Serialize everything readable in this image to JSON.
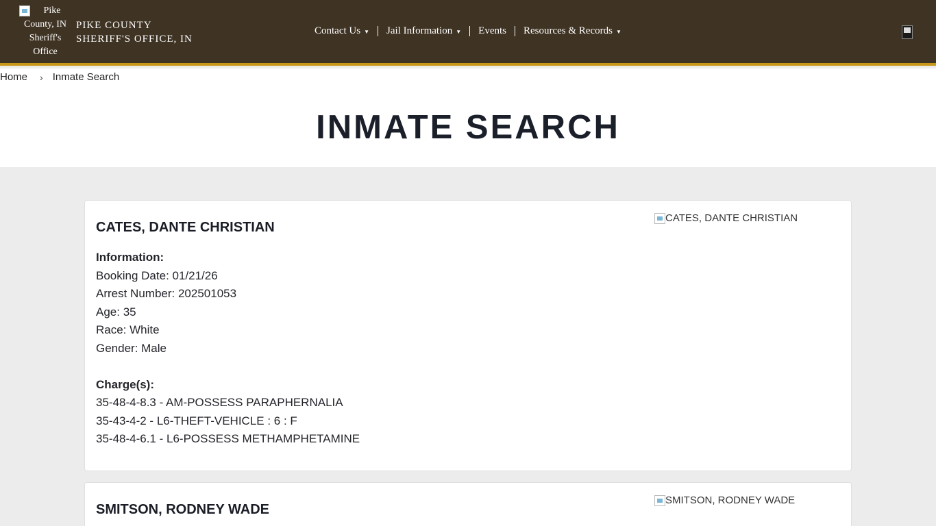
{
  "header": {
    "logo_alt": "Pike County, IN Sheriff's Office",
    "logo_lines": [
      "Pike",
      "County, IN",
      "Sheriff's",
      "Office"
    ],
    "site_name_line1": "PIKE COUNTY",
    "site_name_line2": "SHERIFF'S OFFICE, IN",
    "nav": [
      {
        "label": "Contact Us",
        "has_dropdown": true
      },
      {
        "label": "Jail Information",
        "has_dropdown": true
      },
      {
        "label": "Events",
        "has_dropdown": false
      },
      {
        "label": "Resources & Records",
        "has_dropdown": true
      }
    ],
    "colors": {
      "bar": "#3f3323",
      "accent": "#c9981b"
    }
  },
  "breadcrumb": {
    "home": "Home",
    "separator": "›",
    "current": "Inmate Search"
  },
  "page_title": "INMATE SEARCH",
  "inmates": [
    {
      "name": "CATES, DANTE CHRISTIAN",
      "photo_alt": "CATES, DANTE CHRISTIAN",
      "info_heading": "Information:",
      "booking_date": "Booking Date: 01/21/26",
      "arrest_number": "Arrest Number: 202501053",
      "age": "Age: 35",
      "race": "Race: White",
      "gender": "Gender: Male",
      "charges_heading": "Charge(s):",
      "charges": [
        "35-48-4-8.3 - AM-POSSESS PARAPHERNALIA",
        "35-43-4-2 - L6-THEFT-VEHICLE : 6 : F",
        "35-48-4-6.1 - L6-POSSESS METHAMPHETAMINE"
      ]
    },
    {
      "name": "SMITSON, RODNEY WADE",
      "photo_alt": "SMITSON, RODNEY WADE"
    }
  ]
}
